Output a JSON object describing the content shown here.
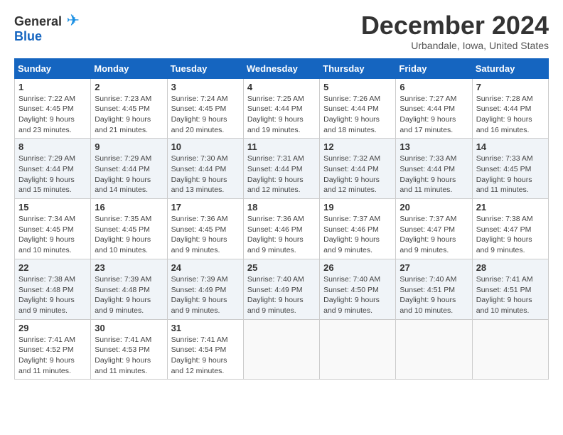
{
  "header": {
    "logo_general": "General",
    "logo_blue": "Blue",
    "month_title": "December 2024",
    "subtitle": "Urbandale, Iowa, United States"
  },
  "days_of_week": [
    "Sunday",
    "Monday",
    "Tuesday",
    "Wednesday",
    "Thursday",
    "Friday",
    "Saturday"
  ],
  "weeks": [
    [
      {
        "day": "1",
        "sunrise": "7:22 AM",
        "sunset": "4:45 PM",
        "daylight": "9 hours and 23 minutes."
      },
      {
        "day": "2",
        "sunrise": "7:23 AM",
        "sunset": "4:45 PM",
        "daylight": "9 hours and 21 minutes."
      },
      {
        "day": "3",
        "sunrise": "7:24 AM",
        "sunset": "4:45 PM",
        "daylight": "9 hours and 20 minutes."
      },
      {
        "day": "4",
        "sunrise": "7:25 AM",
        "sunset": "4:44 PM",
        "daylight": "9 hours and 19 minutes."
      },
      {
        "day": "5",
        "sunrise": "7:26 AM",
        "sunset": "4:44 PM",
        "daylight": "9 hours and 18 minutes."
      },
      {
        "day": "6",
        "sunrise": "7:27 AM",
        "sunset": "4:44 PM",
        "daylight": "9 hours and 17 minutes."
      },
      {
        "day": "7",
        "sunrise": "7:28 AM",
        "sunset": "4:44 PM",
        "daylight": "9 hours and 16 minutes."
      }
    ],
    [
      {
        "day": "8",
        "sunrise": "7:29 AM",
        "sunset": "4:44 PM",
        "daylight": "9 hours and 15 minutes."
      },
      {
        "day": "9",
        "sunrise": "7:29 AM",
        "sunset": "4:44 PM",
        "daylight": "9 hours and 14 minutes."
      },
      {
        "day": "10",
        "sunrise": "7:30 AM",
        "sunset": "4:44 PM",
        "daylight": "9 hours and 13 minutes."
      },
      {
        "day": "11",
        "sunrise": "7:31 AM",
        "sunset": "4:44 PM",
        "daylight": "9 hours and 12 minutes."
      },
      {
        "day": "12",
        "sunrise": "7:32 AM",
        "sunset": "4:44 PM",
        "daylight": "9 hours and 12 minutes."
      },
      {
        "day": "13",
        "sunrise": "7:33 AM",
        "sunset": "4:44 PM",
        "daylight": "9 hours and 11 minutes."
      },
      {
        "day": "14",
        "sunrise": "7:33 AM",
        "sunset": "4:45 PM",
        "daylight": "9 hours and 11 minutes."
      }
    ],
    [
      {
        "day": "15",
        "sunrise": "7:34 AM",
        "sunset": "4:45 PM",
        "daylight": "9 hours and 10 minutes."
      },
      {
        "day": "16",
        "sunrise": "7:35 AM",
        "sunset": "4:45 PM",
        "daylight": "9 hours and 10 minutes."
      },
      {
        "day": "17",
        "sunrise": "7:36 AM",
        "sunset": "4:45 PM",
        "daylight": "9 hours and 9 minutes."
      },
      {
        "day": "18",
        "sunrise": "7:36 AM",
        "sunset": "4:46 PM",
        "daylight": "9 hours and 9 minutes."
      },
      {
        "day": "19",
        "sunrise": "7:37 AM",
        "sunset": "4:46 PM",
        "daylight": "9 hours and 9 minutes."
      },
      {
        "day": "20",
        "sunrise": "7:37 AM",
        "sunset": "4:47 PM",
        "daylight": "9 hours and 9 minutes."
      },
      {
        "day": "21",
        "sunrise": "7:38 AM",
        "sunset": "4:47 PM",
        "daylight": "9 hours and 9 minutes."
      }
    ],
    [
      {
        "day": "22",
        "sunrise": "7:38 AM",
        "sunset": "4:48 PM",
        "daylight": "9 hours and 9 minutes."
      },
      {
        "day": "23",
        "sunrise": "7:39 AM",
        "sunset": "4:48 PM",
        "daylight": "9 hours and 9 minutes."
      },
      {
        "day": "24",
        "sunrise": "7:39 AM",
        "sunset": "4:49 PM",
        "daylight": "9 hours and 9 minutes."
      },
      {
        "day": "25",
        "sunrise": "7:40 AM",
        "sunset": "4:49 PM",
        "daylight": "9 hours and 9 minutes."
      },
      {
        "day": "26",
        "sunrise": "7:40 AM",
        "sunset": "4:50 PM",
        "daylight": "9 hours and 9 minutes."
      },
      {
        "day": "27",
        "sunrise": "7:40 AM",
        "sunset": "4:51 PM",
        "daylight": "9 hours and 10 minutes."
      },
      {
        "day": "28",
        "sunrise": "7:41 AM",
        "sunset": "4:51 PM",
        "daylight": "9 hours and 10 minutes."
      }
    ],
    [
      {
        "day": "29",
        "sunrise": "7:41 AM",
        "sunset": "4:52 PM",
        "daylight": "9 hours and 11 minutes."
      },
      {
        "day": "30",
        "sunrise": "7:41 AM",
        "sunset": "4:53 PM",
        "daylight": "9 hours and 11 minutes."
      },
      {
        "day": "31",
        "sunrise": "7:41 AM",
        "sunset": "4:54 PM",
        "daylight": "9 hours and 12 minutes."
      },
      null,
      null,
      null,
      null
    ]
  ],
  "labels": {
    "sunrise": "Sunrise:",
    "sunset": "Sunset:",
    "daylight": "Daylight:"
  }
}
